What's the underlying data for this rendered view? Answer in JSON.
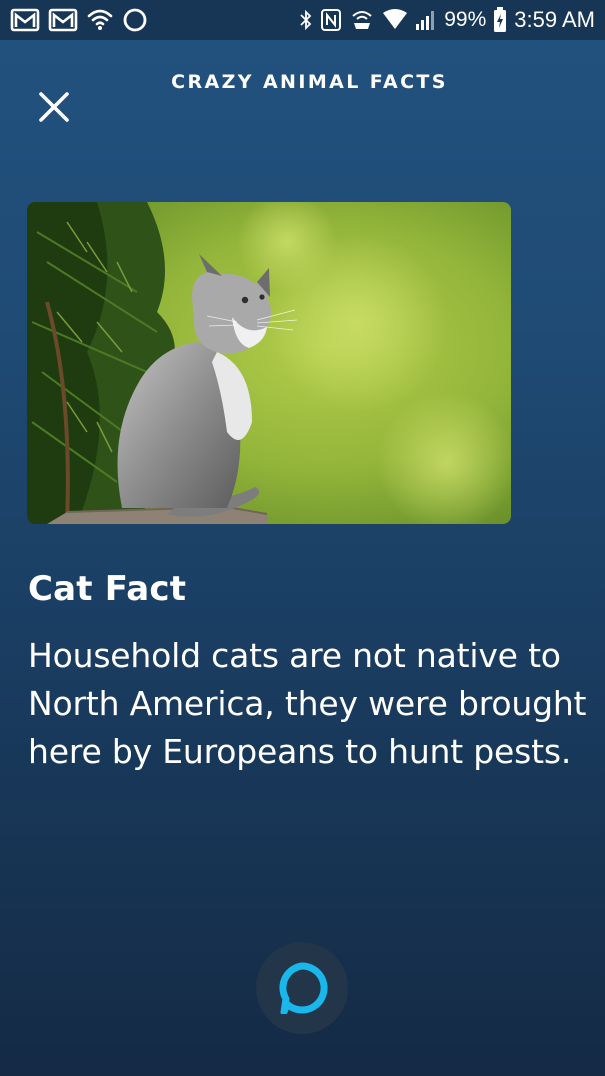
{
  "status_bar": {
    "battery": "99%",
    "time": "3:59 AM",
    "left_icons": [
      "gmail-icon",
      "gmail-icon",
      "wifi-icon",
      "circle-icon"
    ],
    "right_icons": [
      "bluetooth-icon",
      "nfc-icon",
      "hotspot-icon",
      "wifi-signal-icon",
      "cell-signal-icon",
      "battery-icon"
    ]
  },
  "header": {
    "title": "CRAZY ANIMAL FACTS",
    "close_icon": "close-icon"
  },
  "card": {
    "image_subject": "cat-photo",
    "heading": "Cat Fact",
    "body": "Household cats are not native to North America, they were brought here by Europeans to hunt pests."
  },
  "alexa_button": {
    "icon": "alexa-ring-icon",
    "ring_color": "#19b7ea"
  },
  "colors": {
    "background_top": "#22527f",
    "background_bottom": "#142a45",
    "text": "#ffffff"
  }
}
